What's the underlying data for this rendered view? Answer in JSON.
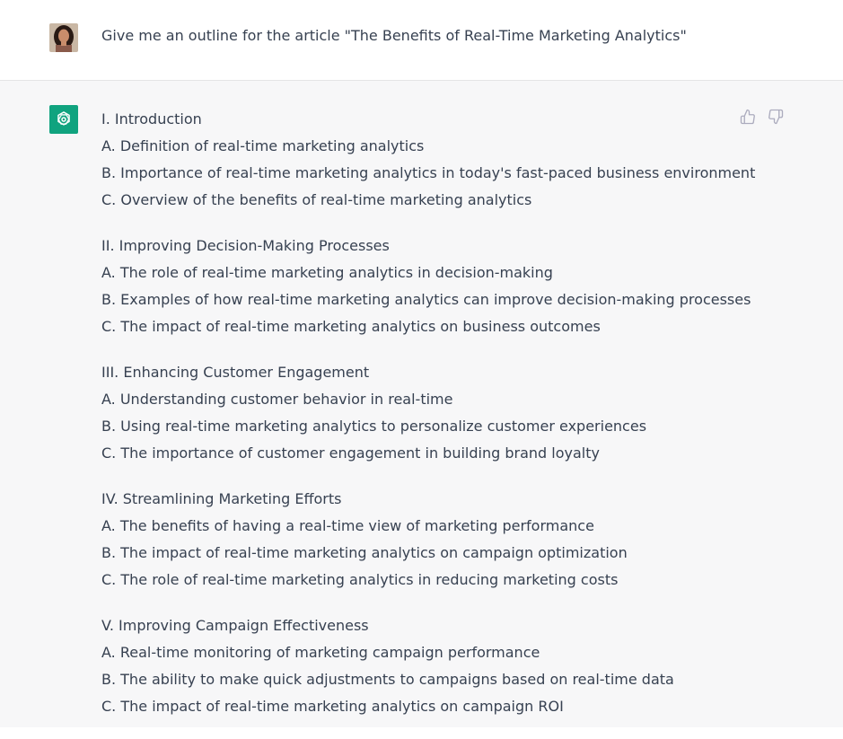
{
  "user": {
    "prompt": "Give me an outline for the article \"The Benefits of Real-Time Marketing Analytics\""
  },
  "assistant": {
    "sections": [
      {
        "heading": "I. Introduction",
        "items": [
          "A. Definition of real-time marketing analytics",
          "B. Importance of real-time marketing analytics in today's fast-paced business environment",
          "C. Overview of the benefits of real-time marketing analytics"
        ]
      },
      {
        "heading": "II. Improving Decision-Making Processes",
        "items": [
          "A. The role of real-time marketing analytics in decision-making",
          "B. Examples of how real-time marketing analytics can improve decision-making processes",
          "C. The impact of real-time marketing analytics on business outcomes"
        ]
      },
      {
        "heading": "III. Enhancing Customer Engagement",
        "items": [
          "A. Understanding customer behavior in real-time",
          "B. Using real-time marketing analytics to personalize customer experiences",
          "C. The importance of customer engagement in building brand loyalty"
        ]
      },
      {
        "heading": "IV. Streamlining Marketing Efforts",
        "items": [
          "A. The benefits of having a real-time view of marketing performance",
          "B. The impact of real-time marketing analytics on campaign optimization",
          "C. The role of real-time marketing analytics in reducing marketing costs"
        ]
      },
      {
        "heading": "V. Improving Campaign Effectiveness",
        "items": [
          "A. Real-time monitoring of marketing campaign performance",
          "B. The ability to make quick adjustments to campaigns based on real-time data",
          "C. The impact of real-time marketing analytics on campaign ROI"
        ]
      }
    ]
  },
  "icons": {
    "assistant_logo": "openai-logo-icon",
    "thumbs_up": "thumbs-up-icon",
    "thumbs_down": "thumbs-down-icon"
  },
  "colors": {
    "brand": "#10a37f",
    "assistant_bg": "#f7f7f8",
    "text": "#374151"
  }
}
